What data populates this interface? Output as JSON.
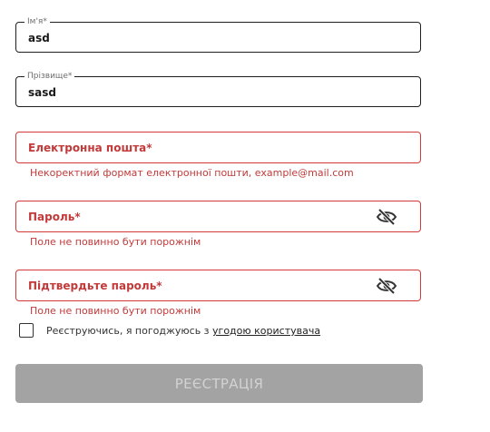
{
  "form": {
    "first_name": {
      "label": "Ім'я*",
      "value": "asd"
    },
    "last_name": {
      "label": "Прізвище*",
      "value": "sasd"
    },
    "email": {
      "placeholder": "Електронна пошта*",
      "error": "Некоректний формат електронної пошти, example@mail.com"
    },
    "password": {
      "placeholder": "Пароль*",
      "error": "Поле не повинно бути порожнім",
      "toggle_icon": "eye-slash-icon"
    },
    "confirm_password": {
      "placeholder": "Підтвердьте пароль*",
      "error": "Поле не повинно бути порожнім",
      "toggle_icon": "eye-slash-icon"
    },
    "agreement": {
      "checked": false,
      "prefix": "Реєструючись, я погоджуюсь з ",
      "link": "угодою користувача"
    },
    "submit_label": "РЕЄСТРАЦІЯ"
  },
  "colors": {
    "error": "#c23a3a",
    "error_border": "#d23a3a",
    "button_disabled_bg": "#a3a3a3",
    "button_disabled_text": "#d2d2d2"
  }
}
